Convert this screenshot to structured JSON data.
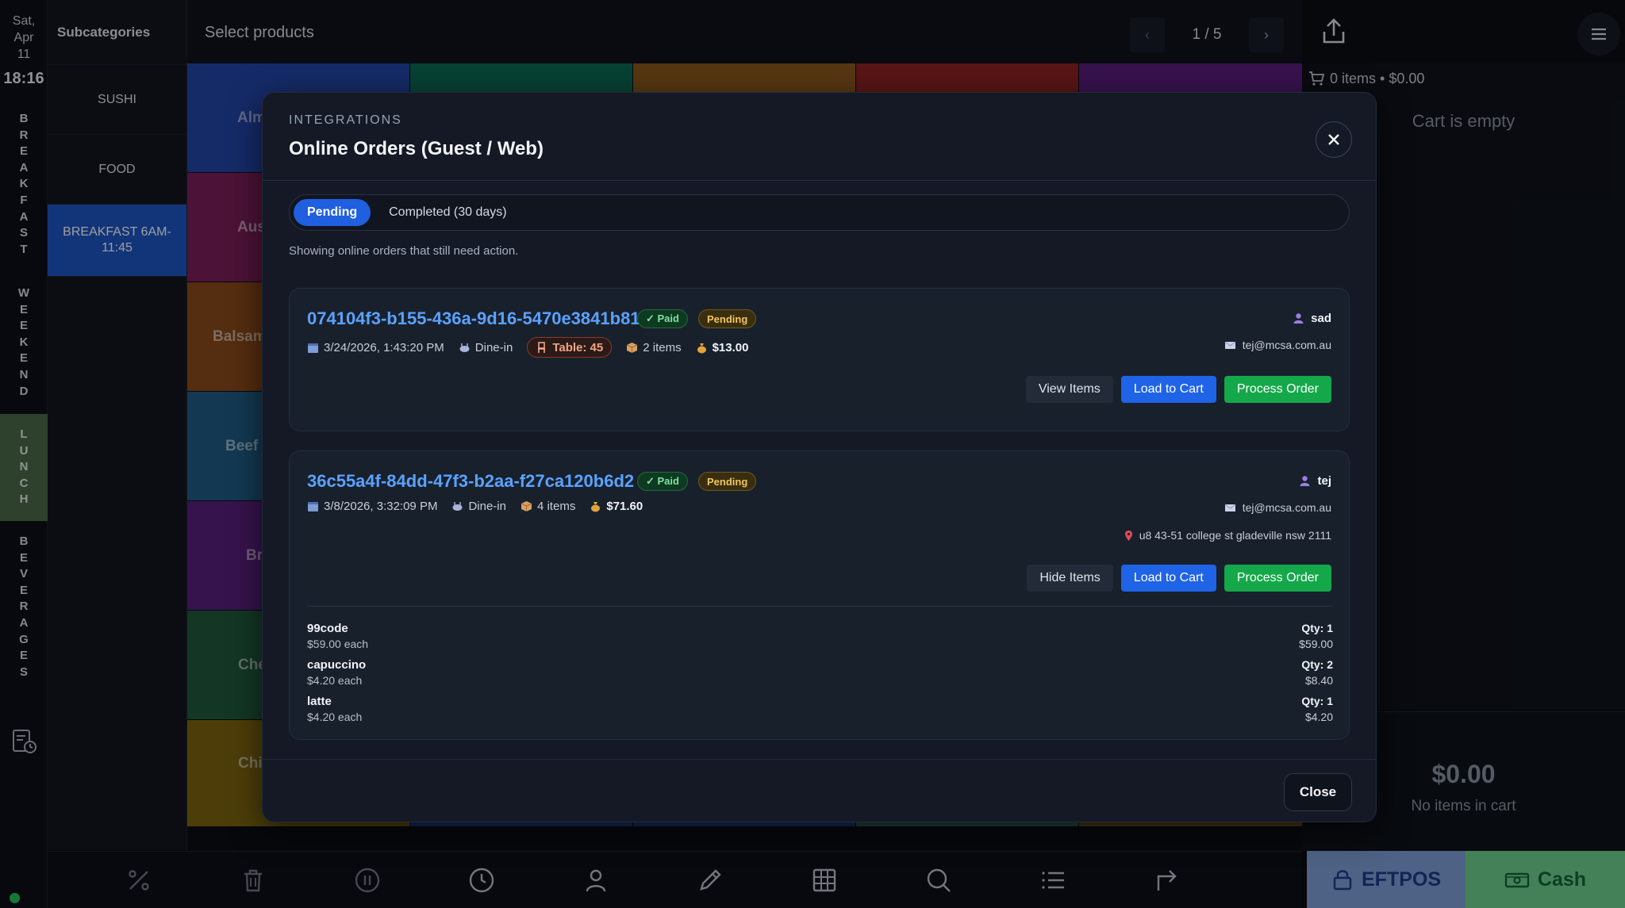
{
  "rail": {
    "day": "Sat,",
    "month": "Apr",
    "date": "11",
    "time": "18:16",
    "categories": [
      "BREAKFAST",
      "WEEKEND",
      "LUNCH",
      "BEVERAGES"
    ],
    "active_category": "LUNCH"
  },
  "subcategories": {
    "header": "Subcategories",
    "items": [
      "SUSHI",
      "FOOD",
      "BREAKFAST 6AM-11:45"
    ],
    "active": "BREAKFAST 6AM-11:45"
  },
  "products": {
    "title": "Select products",
    "pager_label": "1 / 5",
    "prev_icon": "‹",
    "next_icon": "›",
    "tiles": [
      "Alm",
      "Aus",
      "Balsam",
      "Beef",
      "Br",
      "Che",
      "Chi"
    ]
  },
  "cart": {
    "summary": "0 items • $0.00",
    "empty_text": "Cart is empty",
    "total": "$0.00",
    "total_note": "No items in cart"
  },
  "payments": {
    "eftpos": "EFTPOS",
    "cash": "Cash"
  },
  "modal": {
    "eyebrow": "INTEGRATIONS",
    "title": "Online Orders (Guest / Web)",
    "tabs": [
      "Pending",
      "Completed (30 days)"
    ],
    "active_tab": "Pending",
    "helper": "Showing online orders that still need action.",
    "close_label": "Close",
    "orders": [
      {
        "id": "074104f3-b155-436a-9d16-5470e3841b81",
        "paid_badge": "✓ Paid",
        "status_badge": "Pending",
        "datetime": "3/24/2026, 1:43:20 PM",
        "type": "Dine-in",
        "table": "Table: 45",
        "item_count": "2 items",
        "total": "$13.00",
        "customer": "sad",
        "email": "tej@mcsa.com.au",
        "toggle_label": "View Items",
        "load_label": "Load to Cart",
        "process_label": "Process Order"
      },
      {
        "id": "36c55a4f-84dd-47f3-b2aa-f27ca120b6d2",
        "paid_badge": "✓ Paid",
        "status_badge": "Pending",
        "datetime": "3/8/2026, 3:32:09 PM",
        "type": "Dine-in",
        "item_count": "4 items",
        "total": "$71.60",
        "customer": "tej",
        "email": "tej@mcsa.com.au",
        "address": "u8 43-51 college st gladeville nsw 2111",
        "toggle_label": "Hide Items",
        "load_label": "Load to Cart",
        "process_label": "Process Order",
        "items": [
          {
            "name": "99code",
            "each": "$59.00 each",
            "qty": "Qty: 1",
            "line_total": "$59.00"
          },
          {
            "name": "capuccino",
            "each": "$4.20 each",
            "qty": "Qty: 2",
            "line_total": "$8.40"
          },
          {
            "name": "latte",
            "each": "$4.20 each",
            "qty": "Qty: 1",
            "line_total": "$4.20"
          }
        ]
      }
    ]
  },
  "colors": {
    "accent": "#1f63e6",
    "success": "#14a84a",
    "link": "#5aa2ff",
    "pending": "#f2c55c"
  },
  "icons": [
    "upload-icon",
    "hamburger-menu-icon",
    "cart-icon",
    "close-icon",
    "calendar-icon",
    "dine-in-icon",
    "chair-icon",
    "box-icon",
    "money-bag-icon",
    "user-icon",
    "mail-icon",
    "location-pin-icon",
    "percent-icon",
    "trash-icon",
    "pause-icon",
    "clock-icon",
    "person-icon",
    "pencil-icon",
    "table-grid-icon",
    "search-icon",
    "list-icon",
    "redirect-arrow-icon",
    "lock-icon",
    "cash-icon",
    "report-icon"
  ]
}
